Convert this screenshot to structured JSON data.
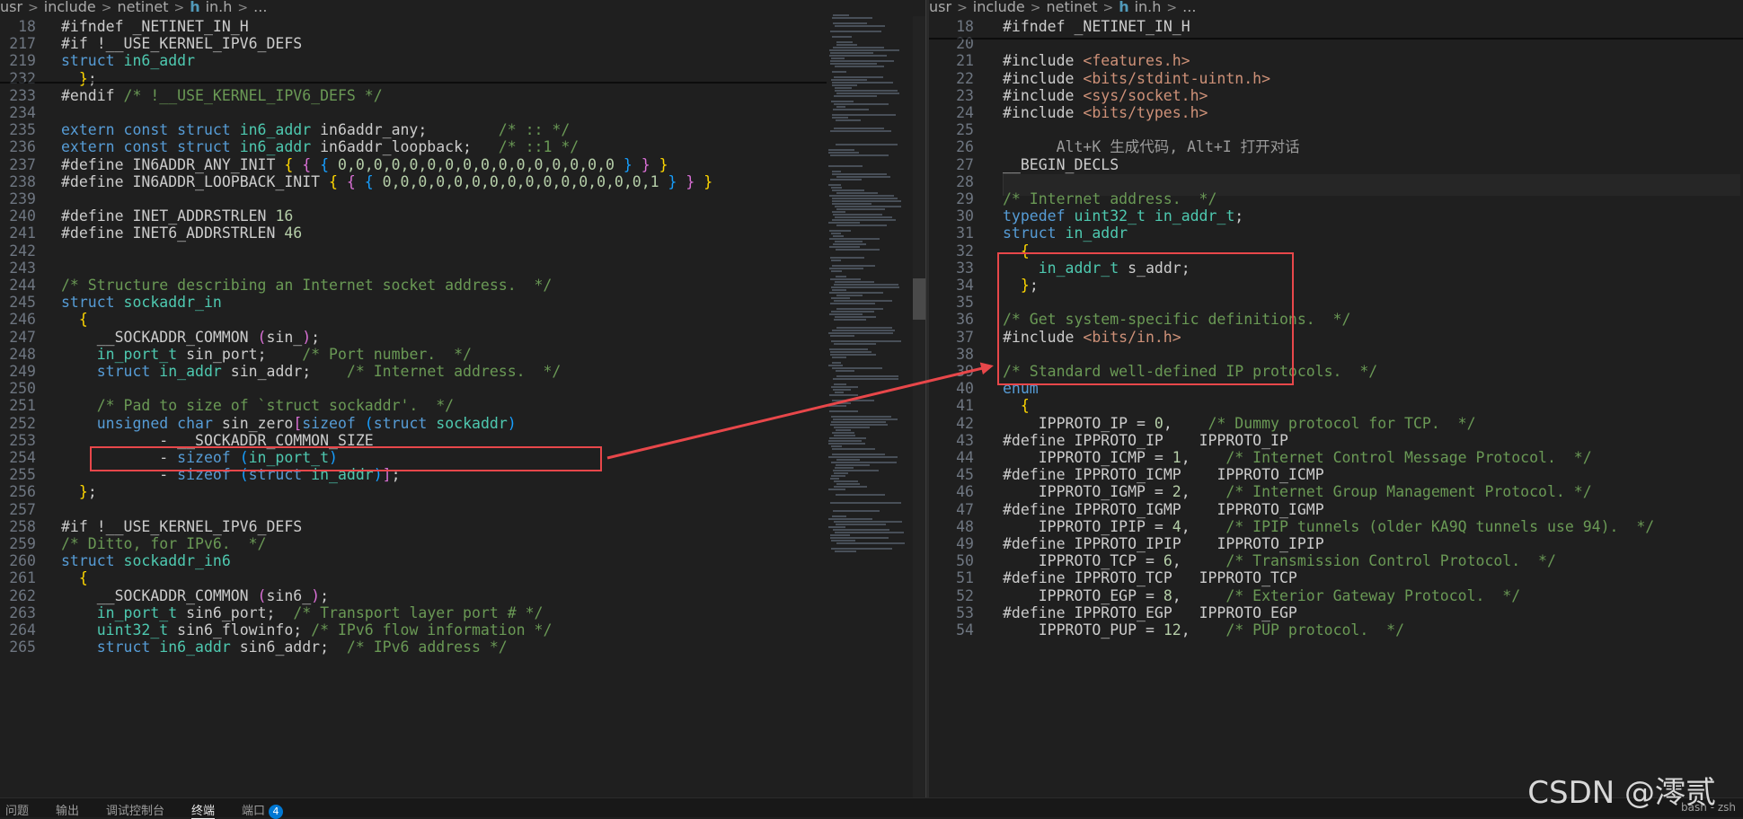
{
  "left_breadcrumb": {
    "parts": [
      "usr",
      "include",
      "netinet",
      "in.h",
      "..."
    ],
    "file_icon": "h-file-icon"
  },
  "right_breadcrumb": {
    "parts": [
      "usr",
      "include",
      "netinet",
      "in.h",
      "..."
    ],
    "file_icon": "h-file-icon"
  },
  "left_code": [
    {
      "n": "18",
      "segs": [
        [
          "d",
          "#ifndef "
        ],
        [
          "d",
          "_NETINET_IN_H"
        ]
      ]
    },
    {
      "n": "217",
      "segs": [
        [
          "d",
          "#if !"
        ],
        [
          "d",
          "__USE_KERNEL_IPV6_DEFS"
        ]
      ]
    },
    {
      "n": "219",
      "segs": [
        [
          "k",
          "struct "
        ],
        [
          "y",
          "in6_addr"
        ]
      ]
    },
    {
      "n": "232",
      "segs": [
        [
          "d",
          "  "
        ],
        [
          "b1",
          "}"
        ],
        [
          "d",
          ";"
        ]
      ]
    },
    {
      "n": "233",
      "segs": [
        [
          "d",
          "#endif "
        ],
        [
          "c",
          "/* !__USE_KERNEL_IPV6_DEFS */"
        ]
      ]
    },
    {
      "n": "234",
      "segs": []
    },
    {
      "n": "235",
      "segs": [
        [
          "k",
          "extern const struct "
        ],
        [
          "y",
          "in6_addr "
        ],
        [
          "d",
          "in6addr_any;        "
        ],
        [
          "c",
          "/* :: */"
        ]
      ]
    },
    {
      "n": "236",
      "segs": [
        [
          "k",
          "extern const struct "
        ],
        [
          "y",
          "in6_addr "
        ],
        [
          "d",
          "in6addr_loopback;   "
        ],
        [
          "c",
          "/* ::1 */"
        ]
      ]
    },
    {
      "n": "237",
      "segs": [
        [
          "d",
          "#define "
        ],
        [
          "m",
          "IN6ADDR_ANY_INIT "
        ],
        [
          "b1",
          "{ "
        ],
        [
          "b2",
          "{ "
        ],
        [
          "b3",
          "{ "
        ],
        [
          "n",
          "0,0,0,0,0,0,0,0,0,0,0,0,0,0,0,0 "
        ],
        [
          "b3",
          "} "
        ],
        [
          "b2",
          "} "
        ],
        [
          "b1",
          "}"
        ]
      ]
    },
    {
      "n": "238",
      "segs": [
        [
          "d",
          "#define "
        ],
        [
          "m",
          "IN6ADDR_LOOPBACK_INIT "
        ],
        [
          "b1",
          "{ "
        ],
        [
          "b2",
          "{ "
        ],
        [
          "b3",
          "{ "
        ],
        [
          "n",
          "0,0,0,0,0,0,0,0,0,0,0,0,0,0,0,1 "
        ],
        [
          "b3",
          "} "
        ],
        [
          "b2",
          "} "
        ],
        [
          "b1",
          "}"
        ]
      ]
    },
    {
      "n": "239",
      "segs": []
    },
    {
      "n": "240",
      "segs": [
        [
          "d",
          "#define "
        ],
        [
          "m",
          "INET_ADDRSTRLEN "
        ],
        [
          "n",
          "16"
        ]
      ]
    },
    {
      "n": "241",
      "segs": [
        [
          "d",
          "#define "
        ],
        [
          "m",
          "INET6_ADDRSTRLEN "
        ],
        [
          "n",
          "46"
        ]
      ]
    },
    {
      "n": "242",
      "segs": []
    },
    {
      "n": "243",
      "segs": []
    },
    {
      "n": "244",
      "segs": [
        [
          "c",
          "/* Structure describing an Internet socket address.  */"
        ]
      ]
    },
    {
      "n": "245",
      "segs": [
        [
          "k",
          "struct "
        ],
        [
          "y",
          "sockaddr_in"
        ]
      ]
    },
    {
      "n": "246",
      "segs": [
        [
          "d",
          "  "
        ],
        [
          "b1",
          "{"
        ]
      ]
    },
    {
      "n": "247",
      "segs": [
        [
          "d",
          "    __SOCKADDR_COMMON "
        ],
        [
          "b2",
          "("
        ],
        [
          "d",
          "sin_"
        ],
        [
          "b2",
          ")"
        ],
        [
          "d",
          ";"
        ]
      ]
    },
    {
      "n": "248",
      "segs": [
        [
          "d",
          "    "
        ],
        [
          "y",
          "in_port_t "
        ],
        [
          "d",
          "sin_port;    "
        ],
        [
          "c",
          "/* Port number.  */"
        ]
      ]
    },
    {
      "n": "249",
      "segs": [
        [
          "d",
          "    "
        ],
        [
          "k",
          "struct "
        ],
        [
          "y",
          "in_addr "
        ],
        [
          "d",
          "sin_addr;    "
        ],
        [
          "c",
          "/* Internet address.  */"
        ]
      ]
    },
    {
      "n": "250",
      "segs": []
    },
    {
      "n": "251",
      "segs": [
        [
          "d",
          "    "
        ],
        [
          "c",
          "/* Pad to size of `struct sockaddr'.  */"
        ]
      ]
    },
    {
      "n": "252",
      "segs": [
        [
          "d",
          "    "
        ],
        [
          "k",
          "unsigned char "
        ],
        [
          "d",
          "sin_zero"
        ],
        [
          "b2",
          "["
        ],
        [
          "k",
          "sizeof "
        ],
        [
          "b3",
          "("
        ],
        [
          "k",
          "struct "
        ],
        [
          "y",
          "sockaddr"
        ],
        [
          "b3",
          ")"
        ]
      ]
    },
    {
      "n": "253",
      "segs": [
        [
          "d",
          "           - __SOCKADDR_COMMON_SIZE"
        ]
      ]
    },
    {
      "n": "254",
      "segs": [
        [
          "d",
          "           - "
        ],
        [
          "k",
          "sizeof "
        ],
        [
          "b3",
          "("
        ],
        [
          "y",
          "in_port_t"
        ],
        [
          "b3",
          ")"
        ]
      ]
    },
    {
      "n": "255",
      "segs": [
        [
          "d",
          "           - "
        ],
        [
          "k",
          "sizeof "
        ],
        [
          "b3",
          "("
        ],
        [
          "k",
          "struct "
        ],
        [
          "y",
          "in_addr"
        ],
        [
          "b3",
          ")"
        ],
        [
          "b2",
          "]"
        ],
        [
          "d",
          ";"
        ]
      ]
    },
    {
      "n": "256",
      "segs": [
        [
          "d",
          "  "
        ],
        [
          "b1",
          "}"
        ],
        [
          "d",
          ";"
        ]
      ]
    },
    {
      "n": "257",
      "segs": []
    },
    {
      "n": "258",
      "segs": [
        [
          "d",
          "#if !__USE_KERNEL_IPV6_DEFS"
        ]
      ]
    },
    {
      "n": "259",
      "segs": [
        [
          "c",
          "/* Ditto, for IPv6.  */"
        ]
      ]
    },
    {
      "n": "260",
      "segs": [
        [
          "k",
          "struct "
        ],
        [
          "y",
          "sockaddr_in6"
        ]
      ]
    },
    {
      "n": "261",
      "segs": [
        [
          "d",
          "  "
        ],
        [
          "b1",
          "{"
        ]
      ]
    },
    {
      "n": "262",
      "segs": [
        [
          "d",
          "    __SOCKADDR_COMMON "
        ],
        [
          "b2",
          "("
        ],
        [
          "d",
          "sin6_"
        ],
        [
          "b2",
          ")"
        ],
        [
          "d",
          ";"
        ]
      ]
    },
    {
      "n": "263",
      "segs": [
        [
          "d",
          "    "
        ],
        [
          "y",
          "in_port_t "
        ],
        [
          "d",
          "sin6_port;  "
        ],
        [
          "c",
          "/* Transport layer port # */"
        ]
      ]
    },
    {
      "n": "264",
      "segs": [
        [
          "d",
          "    "
        ],
        [
          "y",
          "uint32_t "
        ],
        [
          "d",
          "sin6_flowinfo; "
        ],
        [
          "c",
          "/* IPv6 flow information */"
        ]
      ]
    },
    {
      "n": "265",
      "segs": [
        [
          "d",
          "    "
        ],
        [
          "k",
          "struct "
        ],
        [
          "y",
          "in6_addr "
        ],
        [
          "d",
          "sin6_addr;  "
        ],
        [
          "c",
          "/* IPv6 address */"
        ]
      ]
    }
  ],
  "right_code": [
    {
      "n": "18",
      "segs": [
        [
          "d",
          "#ifndef "
        ],
        [
          "d",
          "_NETINET_IN_H"
        ]
      ]
    },
    {
      "n": "20",
      "segs": []
    },
    {
      "n": "21",
      "segs": [
        [
          "d",
          "#include "
        ],
        [
          "s",
          "<features.h>"
        ]
      ]
    },
    {
      "n": "22",
      "segs": [
        [
          "d",
          "#include "
        ],
        [
          "s",
          "<bits/stdint-uintn.h>"
        ]
      ]
    },
    {
      "n": "23",
      "segs": [
        [
          "d",
          "#include "
        ],
        [
          "s",
          "<sys/socket.h>"
        ]
      ]
    },
    {
      "n": "24",
      "segs": [
        [
          "d",
          "#include "
        ],
        [
          "s",
          "<bits/types.h>"
        ]
      ]
    },
    {
      "n": "25",
      "segs": []
    },
    {
      "n": "26",
      "segs": [
        [
          "h",
          "      Alt+K 生成代码, Alt+I 打开对话"
        ]
      ]
    },
    {
      "n": "27",
      "segs": [
        [
          "d",
          "__BEGIN_DECLS"
        ]
      ]
    },
    {
      "n": "28",
      "segs": []
    },
    {
      "n": "29",
      "segs": [
        [
          "c",
          "/* Internet address.  */"
        ]
      ]
    },
    {
      "n": "30",
      "segs": [
        [
          "k",
          "typedef "
        ],
        [
          "y",
          "uint32_t "
        ],
        [
          "y",
          "in_addr_t"
        ],
        [
          "d",
          ";"
        ]
      ]
    },
    {
      "n": "31",
      "segs": [
        [
          "k",
          "struct "
        ],
        [
          "y",
          "in_addr"
        ]
      ]
    },
    {
      "n": "32",
      "segs": [
        [
          "d",
          "  "
        ],
        [
          "b1",
          "{"
        ]
      ]
    },
    {
      "n": "33",
      "segs": [
        [
          "d",
          "    "
        ],
        [
          "y",
          "in_addr_t "
        ],
        [
          "d",
          "s_addr;"
        ]
      ]
    },
    {
      "n": "34",
      "segs": [
        [
          "d",
          "  "
        ],
        [
          "b1",
          "}"
        ],
        [
          "d",
          ";"
        ]
      ]
    },
    {
      "n": "35",
      "segs": []
    },
    {
      "n": "36",
      "segs": [
        [
          "c",
          "/* Get system-specific definitions.  */"
        ]
      ]
    },
    {
      "n": "37",
      "segs": [
        [
          "d",
          "#include "
        ],
        [
          "s",
          "<bits/in.h>"
        ]
      ]
    },
    {
      "n": "38",
      "segs": []
    },
    {
      "n": "39",
      "segs": [
        [
          "c",
          "/* Standard well-defined IP protocols.  */"
        ]
      ]
    },
    {
      "n": "40",
      "segs": [
        [
          "k",
          "enum"
        ]
      ]
    },
    {
      "n": "41",
      "segs": [
        [
          "d",
          "  "
        ],
        [
          "b1",
          "{"
        ]
      ]
    },
    {
      "n": "42",
      "segs": [
        [
          "d",
          "    IPPROTO_IP = "
        ],
        [
          "n",
          "0"
        ],
        [
          "d",
          ",    "
        ],
        [
          "c",
          "/* Dummy protocol for TCP.  */"
        ]
      ]
    },
    {
      "n": "43",
      "segs": [
        [
          "d",
          "#define "
        ],
        [
          "m",
          "IPPROTO_IP    "
        ],
        [
          "d",
          "IPPROTO_IP"
        ]
      ]
    },
    {
      "n": "44",
      "segs": [
        [
          "d",
          "    IPPROTO_ICMP = "
        ],
        [
          "n",
          "1"
        ],
        [
          "d",
          ",    "
        ],
        [
          "c",
          "/* Internet Control Message Protocol.  */"
        ]
      ]
    },
    {
      "n": "45",
      "segs": [
        [
          "d",
          "#define "
        ],
        [
          "m",
          "IPPROTO_ICMP    "
        ],
        [
          "d",
          "IPPROTO_ICMP"
        ]
      ]
    },
    {
      "n": "46",
      "segs": [
        [
          "d",
          "    IPPROTO_IGMP = "
        ],
        [
          "n",
          "2"
        ],
        [
          "d",
          ",    "
        ],
        [
          "c",
          "/* Internet Group Management Protocol. */"
        ]
      ]
    },
    {
      "n": "47",
      "segs": [
        [
          "d",
          "#define "
        ],
        [
          "m",
          "IPPROTO_IGMP    "
        ],
        [
          "d",
          "IPPROTO_IGMP"
        ]
      ]
    },
    {
      "n": "48",
      "segs": [
        [
          "d",
          "    IPPROTO_IPIP = "
        ],
        [
          "n",
          "4"
        ],
        [
          "d",
          ",    "
        ],
        [
          "c",
          "/* IPIP tunnels (older KA9Q tunnels use 94).  */"
        ]
      ]
    },
    {
      "n": "49",
      "segs": [
        [
          "d",
          "#define "
        ],
        [
          "m",
          "IPPROTO_IPIP    "
        ],
        [
          "d",
          "IPPROTO_IPIP"
        ]
      ]
    },
    {
      "n": "50",
      "segs": [
        [
          "d",
          "    IPPROTO_TCP = "
        ],
        [
          "n",
          "6"
        ],
        [
          "d",
          ",     "
        ],
        [
          "c",
          "/* Transmission Control Protocol.  */"
        ]
      ]
    },
    {
      "n": "51",
      "segs": [
        [
          "d",
          "#define "
        ],
        [
          "m",
          "IPPROTO_TCP   "
        ],
        [
          "d",
          "IPPROTO_TCP"
        ]
      ]
    },
    {
      "n": "52",
      "segs": [
        [
          "d",
          "    IPPROTO_EGP = "
        ],
        [
          "n",
          "8"
        ],
        [
          "d",
          ",     "
        ],
        [
          "c",
          "/* Exterior Gateway Protocol.  */"
        ]
      ]
    },
    {
      "n": "53",
      "segs": [
        [
          "d",
          "#define "
        ],
        [
          "m",
          "IPPROTO_EGP   "
        ],
        [
          "d",
          "IPPROTO_EGP"
        ]
      ]
    },
    {
      "n": "54",
      "segs": [
        [
          "d",
          "    IPPROTO_PUP = "
        ],
        [
          "n",
          "12"
        ],
        [
          "d",
          ",    "
        ],
        [
          "c",
          "/* PUP protocol.  */"
        ]
      ]
    }
  ],
  "panel_tabs": [
    {
      "label": "问题",
      "active": false
    },
    {
      "label": "输出",
      "active": false
    },
    {
      "label": "调试控制台",
      "active": false
    },
    {
      "label": "终端",
      "active": true
    },
    {
      "label": "端口",
      "active": false,
      "badge": "4"
    }
  ],
  "status_right": "bash - zsh",
  "watermark": "CSDN @澪贰",
  "colors": {
    "background": "#1f1f1f",
    "highlight_box": "#e8474a",
    "arrow": "#e8474a"
  }
}
